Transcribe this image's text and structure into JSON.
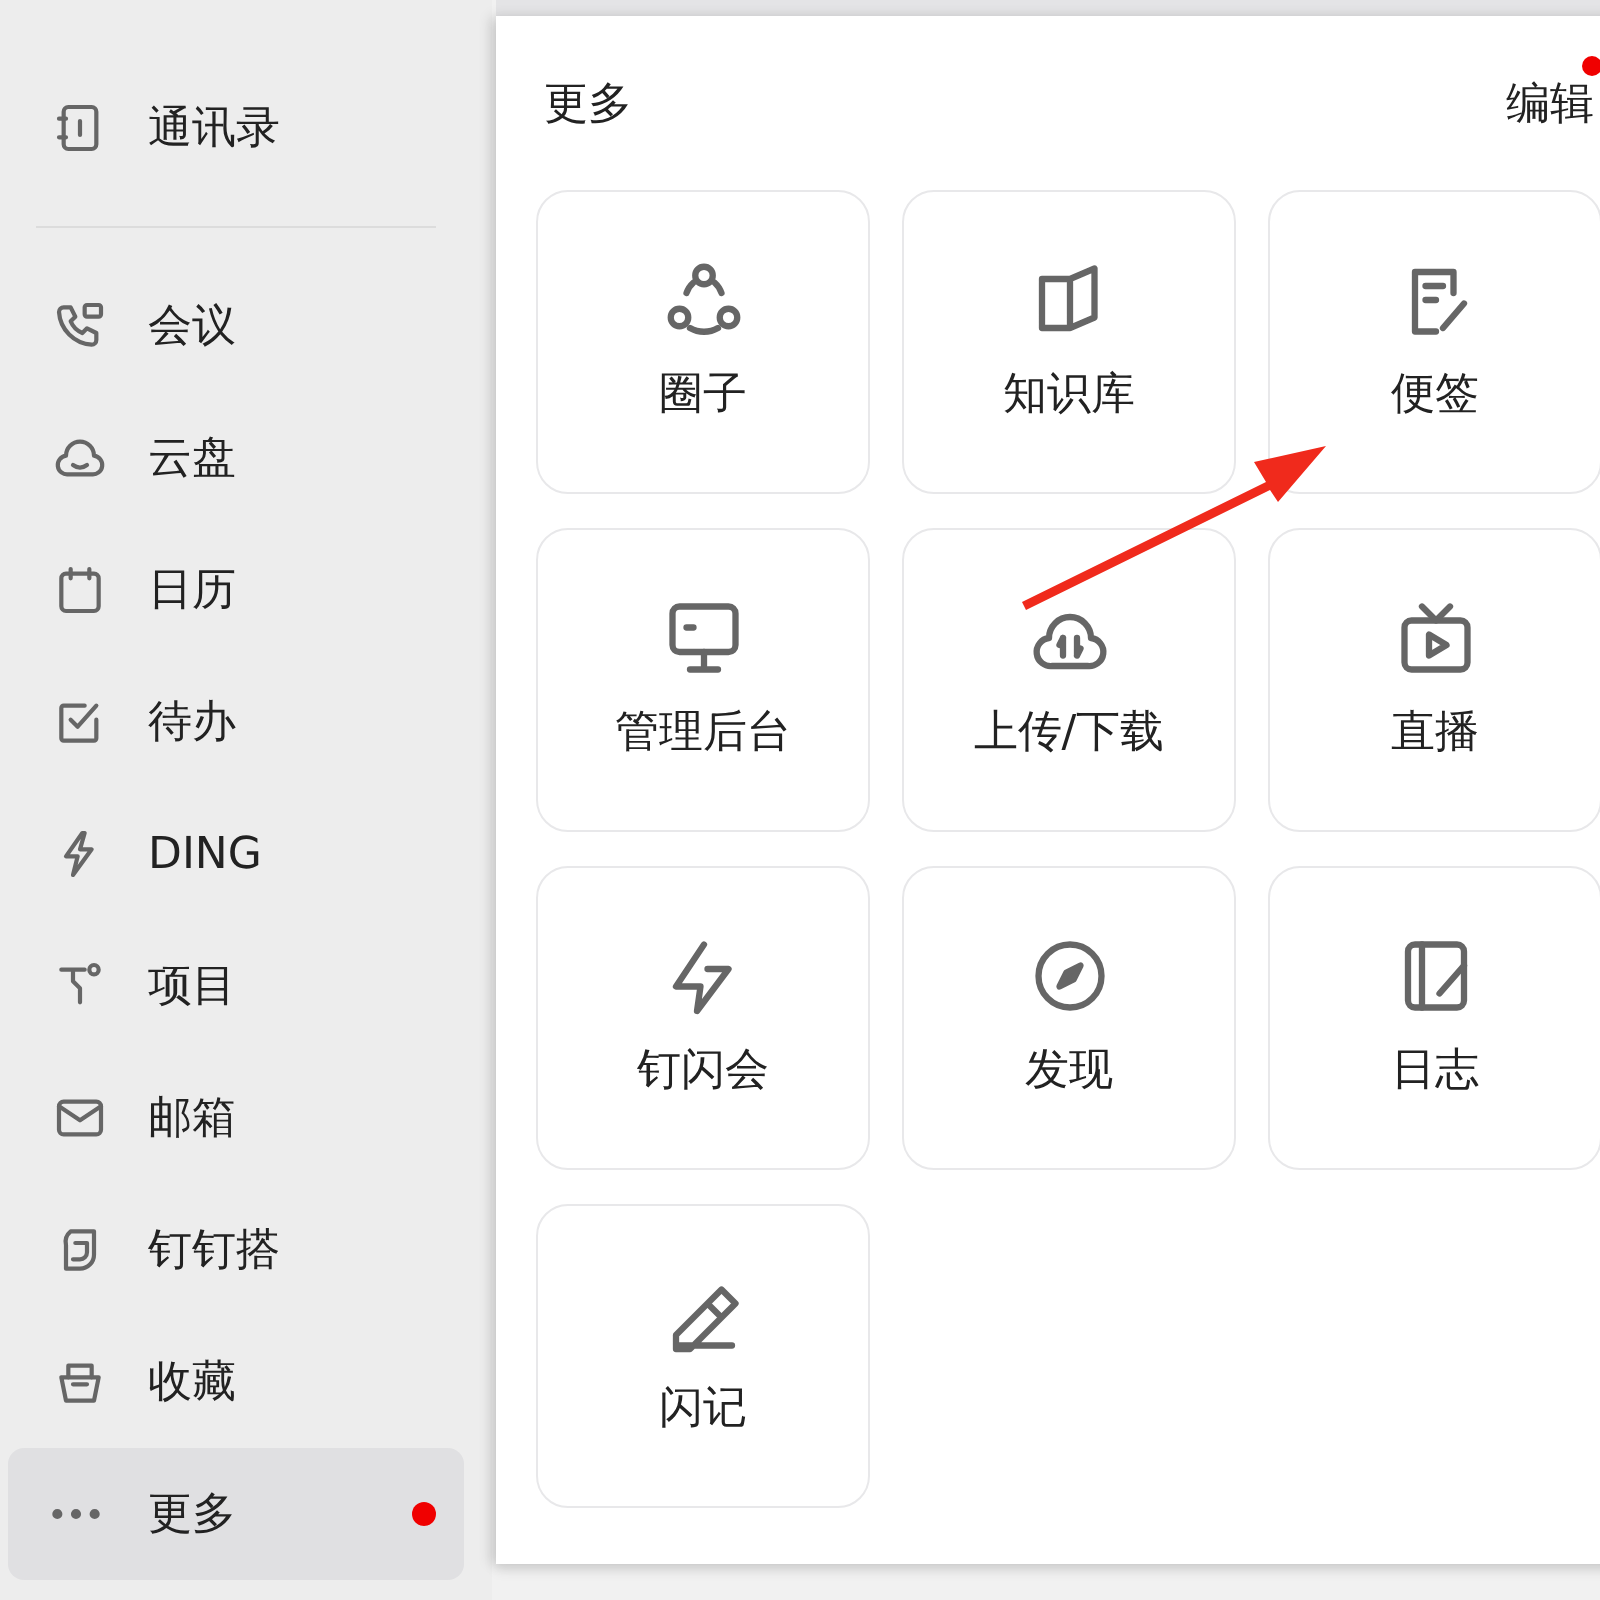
{
  "sidebar": {
    "sections": [
      {
        "items": [
          {
            "label": "通讯录",
            "selected": false,
            "notify": false
          }
        ]
      },
      {
        "items": [
          {
            "label": "会议",
            "selected": false,
            "notify": false
          },
          {
            "label": "云盘",
            "selected": false,
            "notify": false
          },
          {
            "label": "日历",
            "selected": false,
            "notify": false
          },
          {
            "label": "待办",
            "selected": false,
            "notify": false
          },
          {
            "label": "DING",
            "selected": false,
            "notify": false
          },
          {
            "label": "项目",
            "selected": false,
            "notify": false
          },
          {
            "label": "邮箱",
            "selected": false,
            "notify": false
          },
          {
            "label": "钉钉搭",
            "selected": false,
            "notify": false
          },
          {
            "label": "收藏",
            "selected": false,
            "notify": false
          },
          {
            "label": "更多",
            "selected": true,
            "notify": true
          }
        ]
      }
    ]
  },
  "more_panel": {
    "title": "更多",
    "edit": {
      "label": "编辑",
      "notify": true
    },
    "tiles": [
      {
        "label": "圈子"
      },
      {
        "label": "知识库"
      },
      {
        "label": "便签"
      },
      {
        "label": "管理后台"
      },
      {
        "label": "上传/下载"
      },
      {
        "label": "直播"
      },
      {
        "label": "钉闪会"
      },
      {
        "label": "发现"
      },
      {
        "label": "日志"
      },
      {
        "label": "闪记"
      }
    ]
  }
}
